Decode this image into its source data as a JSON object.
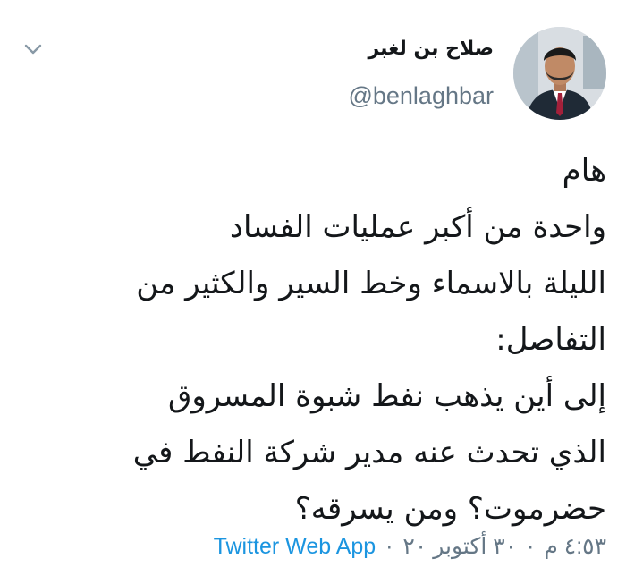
{
  "author": {
    "display_name": "صلاح بن لغبر",
    "handle": "@benlaghbar"
  },
  "tweet": {
    "lines": [
      "هام",
      "واحدة من أكبر عمليات الفساد",
      "الليلة بالاسماء وخط السير والكثير من",
      "التفاصل:",
      "إلى أين يذهب نفط شبوة المسروق",
      "الذي تحدث عنه مدير شركة النفط في",
      "حضرموت؟ ومن يسرقه؟"
    ]
  },
  "meta": {
    "time": "٤:٥٣ م",
    "separator": "·",
    "date": "٣٠ أكتوبر ٢٠",
    "source": "Twitter Web App"
  },
  "icons": {
    "menu": "chevron-down-icon"
  },
  "colors": {
    "text": "#14171a",
    "secondary": "#657786",
    "link": "#1b95e0"
  }
}
